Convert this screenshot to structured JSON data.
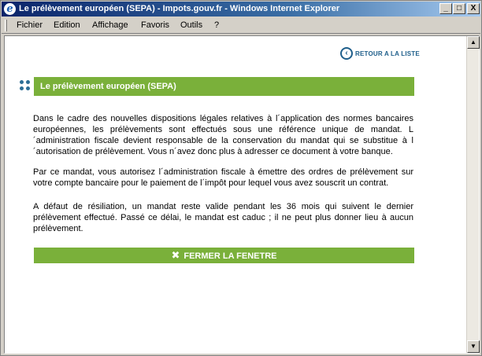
{
  "window": {
    "title": "Le prélèvement européen (SEPA) - Impots.gouv.fr - Windows Internet Explorer",
    "app_icon": "ie-icon",
    "controls": {
      "minimize": "_",
      "maximize": "□",
      "close": "X"
    }
  },
  "menubar": {
    "items": [
      "Fichier",
      "Edition",
      "Affichage",
      "Favoris",
      "Outils",
      "?"
    ]
  },
  "page": {
    "back_link": "RETOUR A LA LISTE",
    "section_title": "Le prélèvement européen (SEPA)",
    "paragraphs": [
      "Dans le cadre des nouvelles dispositions légales relatives à l´application des normes bancaires européennes, les prélèvements sont effectués sous une référence unique de mandat. L´administration fiscale devient responsable de la conservation du mandat qui se substitue à l´autorisation de prélèvement. Vous n´avez donc plus à adresser ce document à votre banque.",
      "Par ce mandat, vous autorisez l´administration fiscale à émettre des ordres de prélèvement sur votre compte bancaire pour le paiement de l´impôt pour lequel vous avez souscrit un contrat.",
      "A défaut de résiliation, un mandat reste valide pendant les 36 mois qui suivent le dernier prélèvement effectué. Passé ce délai, le mandat est caduc ; il ne peut plus donner lieu à aucun prélèvement."
    ],
    "close_button": "FERMER LA FENETRE"
  },
  "colors": {
    "accent_green": "#7ab03a",
    "link_blue": "#1f5f8b",
    "titlebar_start": "#0a246a"
  }
}
